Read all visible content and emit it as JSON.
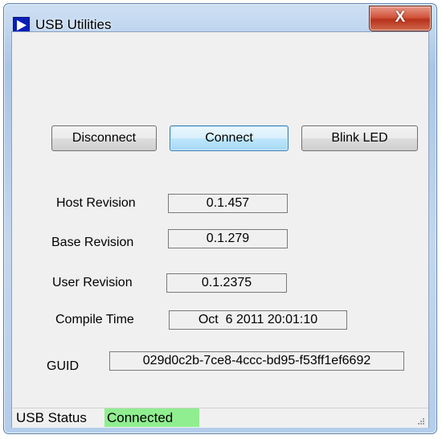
{
  "window": {
    "title": "USB Utilities",
    "close_label": "X"
  },
  "buttons": {
    "disconnect": "Disconnect",
    "connect": "Connect",
    "blink_led": "Blink LED"
  },
  "info": {
    "host_revision_label": "Host Revision",
    "host_revision_value": "0.1.457",
    "base_revision_label": "Base Revision",
    "base_revision_value": "0.1.279",
    "user_revision_label": "User Revision",
    "user_revision_value": "0.1.2375",
    "compile_time_label": "Compile Time",
    "compile_time_value": "Oct  6 2011 20:01:10",
    "guid_label": "GUID",
    "guid_value": "029d0c2b-7ce8-4ccc-bd95-f53ff1ef6692"
  },
  "status": {
    "label": "USB Status",
    "value": "Connected",
    "value_color": "#90ee90"
  },
  "colors": {
    "app_icon_bg": "#0a1fb8",
    "close_button": "#c8452c"
  },
  "icons": {
    "app": "play-triangle-icon",
    "close": "close-icon",
    "grip": "resize-grip-icon"
  }
}
